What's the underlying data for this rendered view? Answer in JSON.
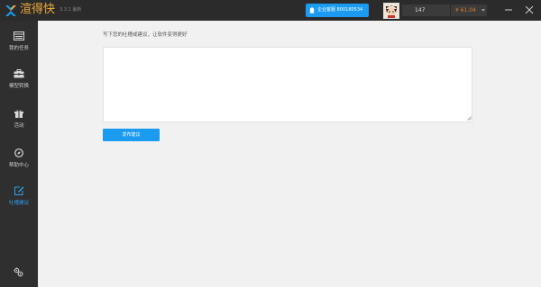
{
  "titlebar": {
    "app_name": "渲得快",
    "version": "3.3.1 最新",
    "enterprise_qq_label": "企业客服 800180534",
    "points": "147",
    "balance": "¥ 61.04"
  },
  "sidebar": {
    "items": [
      {
        "label": "我的任务",
        "icon": "task-list-icon"
      },
      {
        "label": "模型转换",
        "icon": "model-convert-icon"
      },
      {
        "label": "活动",
        "icon": "gift-icon"
      },
      {
        "label": "帮助中心",
        "icon": "compass-icon"
      },
      {
        "label": "吐槽建议",
        "icon": "edit-icon"
      }
    ],
    "active_index": 4,
    "settings_icon": "settings-icon"
  },
  "main": {
    "prompt": "写下您的吐槽或建议，让软件变得更好",
    "feedback_value": "",
    "submit_label": "发布建议"
  },
  "colors": {
    "accent": "#1a9bf0",
    "titlebar_bg": "#2b2b2b",
    "sidebar_bg": "#2f2f2f",
    "balance": "#e07a2e",
    "brand": "#f0a93b"
  }
}
